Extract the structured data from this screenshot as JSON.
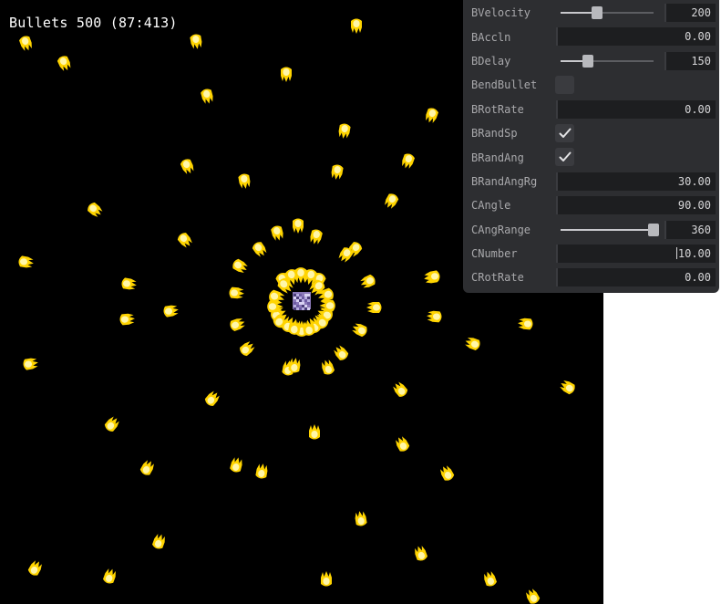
{
  "hud": {
    "text": "Bullets 500 (87:413)"
  },
  "colors": {
    "background": "#000000",
    "bullet_outer": "#ffd400",
    "bullet_inner": "#fff6a8",
    "emitter": "#8a78b8",
    "panel": "#2d2e31",
    "label": "#a8a8ab",
    "value": "#d6d6d8"
  },
  "panel": {
    "rows": [
      {
        "label": "BVelocity",
        "type": "slider",
        "value": "200",
        "fraction": 0.39
      },
      {
        "label": "BAccln",
        "type": "number",
        "value": "0.00"
      },
      {
        "label": "BDelay",
        "type": "slider",
        "value": "150",
        "fraction": 0.29
      },
      {
        "label": "BendBullet",
        "type": "checkbox",
        "checked": false
      },
      {
        "label": "BRotRate",
        "type": "number",
        "value": "0.00"
      },
      {
        "label": "BRandSp",
        "type": "checkbox",
        "checked": true
      },
      {
        "label": "BRandAng",
        "type": "checkbox",
        "checked": true
      },
      {
        "label": "BRandAngRg",
        "type": "number",
        "value": "30.00"
      },
      {
        "label": "CAngle",
        "type": "number",
        "value": "90.00"
      },
      {
        "label": "CAngRange",
        "type": "slider",
        "value": "360",
        "fraction": 1.0
      },
      {
        "label": "CNumber",
        "type": "number",
        "value": "10.00",
        "focused": true
      },
      {
        "label": "CRotRate",
        "type": "number",
        "value": "0.00"
      }
    ]
  },
  "icons": {
    "check": "check-icon",
    "bullet": "flame-bullet-icon",
    "emitter": "emitter-icon"
  }
}
